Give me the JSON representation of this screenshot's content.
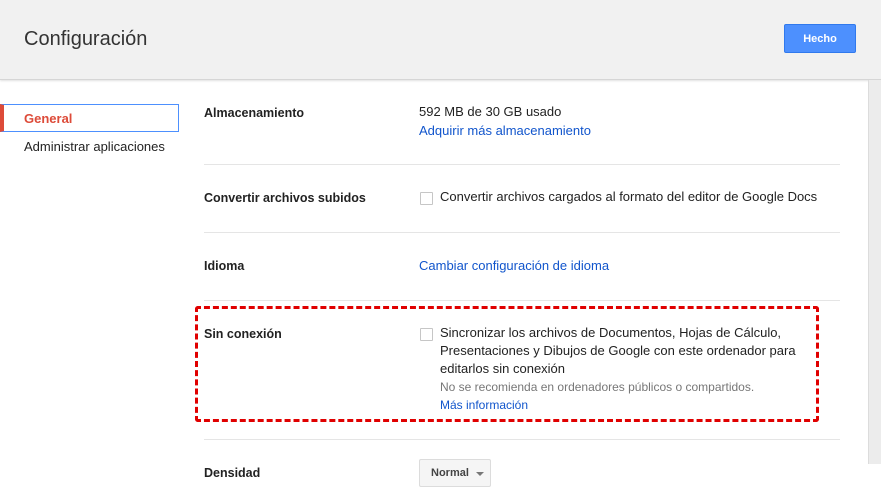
{
  "header": {
    "title": "Configuración",
    "done_label": "Hecho"
  },
  "sidebar": {
    "items": [
      {
        "label": "General",
        "active": true
      },
      {
        "label": "Administrar aplicaciones",
        "active": false
      }
    ]
  },
  "settings": {
    "storage": {
      "label": "Almacenamiento",
      "usage": "592 MB de 30 GB usado",
      "link": "Adquirir más almacenamiento"
    },
    "convert": {
      "label": "Convertir archivos subidos",
      "checkbox_text": "Convertir archivos cargados al formato del editor de Google Docs",
      "checked": false
    },
    "language": {
      "label": "Idioma",
      "link": "Cambiar configuración de idioma"
    },
    "offline": {
      "label": "Sin conexión",
      "checkbox_line1": "Sincronizar los archivos de Documentos, Hojas de Cálculo,",
      "checkbox_line2": "Presentaciones y Dibujos de Google con este ordenador para",
      "checkbox_line3": "editarlos sin conexión",
      "hint": "No se recomienda en ordenadores públicos o compartidos.",
      "link": "Más información",
      "checked": false
    },
    "density": {
      "label": "Densidad",
      "selected": "Normal"
    }
  },
  "colors": {
    "accent": "#4d90fe",
    "active_nav": "#dd4b39",
    "link": "#1155cc",
    "highlight": "#e00000"
  }
}
